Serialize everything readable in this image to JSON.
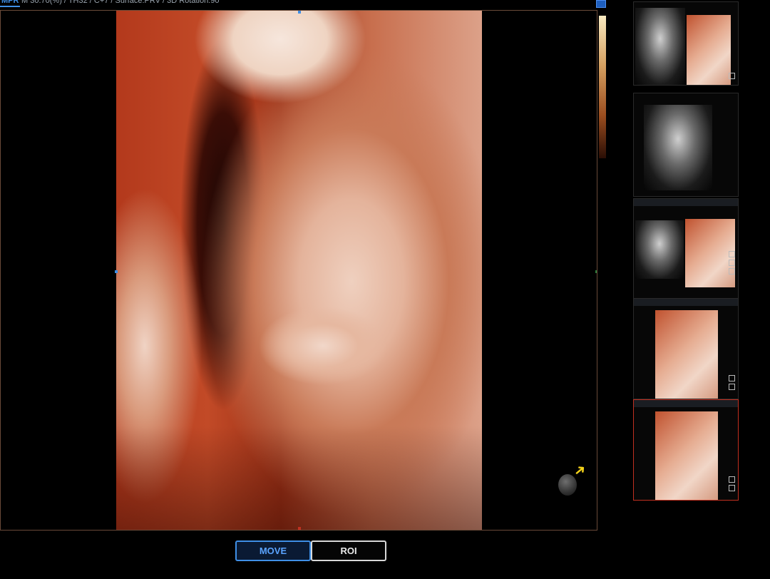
{
  "header": {
    "tab_label": "MPR",
    "status_text": "M 30.70(%) / TH32 / C+7 / Surface:PRV / 3D Rotation:90"
  },
  "controls": {
    "move_label": "MOVE",
    "roi_label": "ROI"
  },
  "thumbnails": [
    {
      "type": "dual"
    },
    {
      "type": "gray"
    },
    {
      "type": "dual"
    },
    {
      "type": "skin"
    },
    {
      "type": "skin",
      "selected": true
    }
  ],
  "colors": {
    "accent": "#3f8fe6",
    "selected_border": "#c03020",
    "pointer_arrow": "#f3d21a"
  }
}
